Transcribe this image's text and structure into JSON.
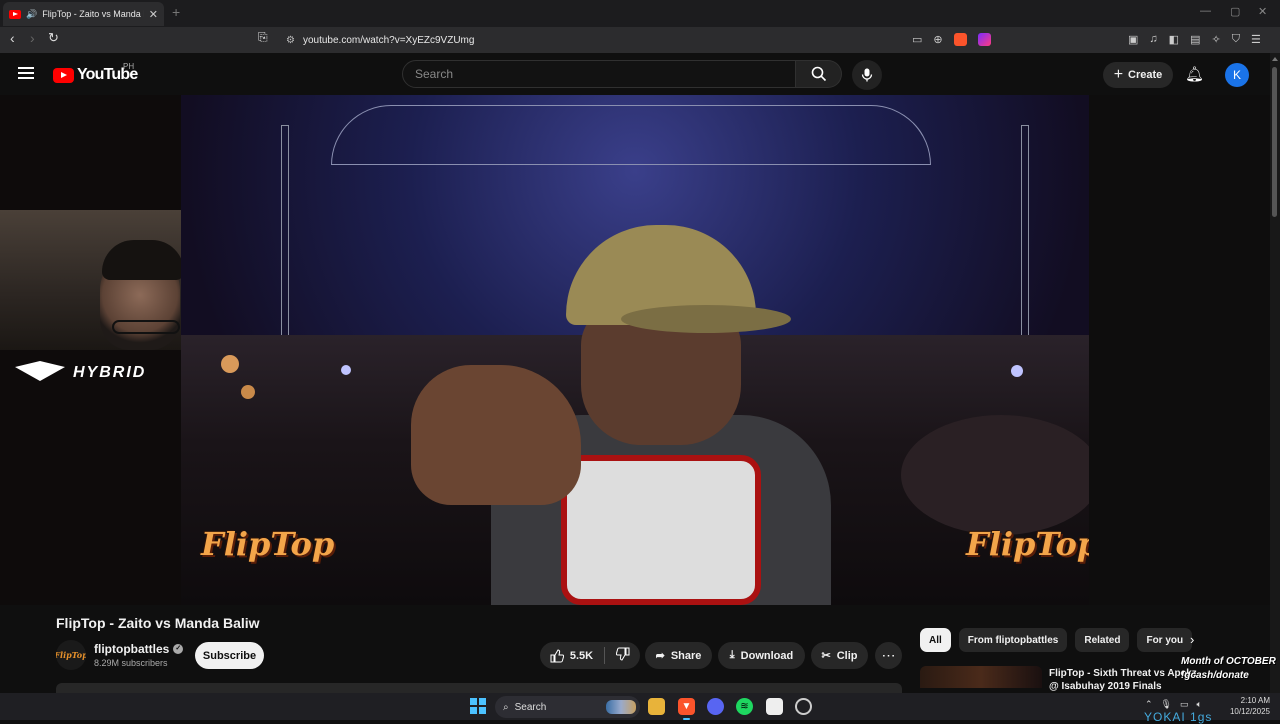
{
  "browser": {
    "tab_title": "FlipTop - Zaito vs Manda Baliw",
    "tab_close": "✕",
    "new_tab": "+",
    "url": "youtube.com/watch?v=XyEZc9VZUmg"
  },
  "youtube": {
    "logo_text": "YouTube",
    "country_code": "PH",
    "search_placeholder": "Search",
    "create_label": "Create",
    "avatar_letter": "K"
  },
  "player": {
    "overlay_logo": "HYBRID",
    "watermark_left": "FlipTop",
    "watermark_right": "FlipTop"
  },
  "video": {
    "title": "FlipTop - Zaito vs Manda Baliw",
    "channel_name": "fliptopbattles",
    "channel_avatar_text": "FlipTop",
    "subscribers": "8.29M subscribers",
    "subscribe_label": "Subscribe",
    "likes": "5.5K",
    "share_label": "Share",
    "download_label": "Download",
    "clip_label": "Clip"
  },
  "sidebar": {
    "chips": [
      "All",
      "From fliptopbattles",
      "Related",
      "For you"
    ],
    "recommendation_title": "FlipTop - Sixth Threat vs Apekz @ Isabuhay 2019 Finals"
  },
  "overlay": {
    "line1": "Month of OCTOBER",
    "line2": "!gcash/donate"
  },
  "taskbar": {
    "search_label": "Search",
    "time": "2:10 AM",
    "date": "10/12/2025"
  },
  "stream": {
    "label": "YOKAI 1gs"
  },
  "colors": {
    "youtube_red": "#ff0000",
    "accent_blue": "#1a73e8",
    "fliptop_orange": "#f3a54a"
  }
}
